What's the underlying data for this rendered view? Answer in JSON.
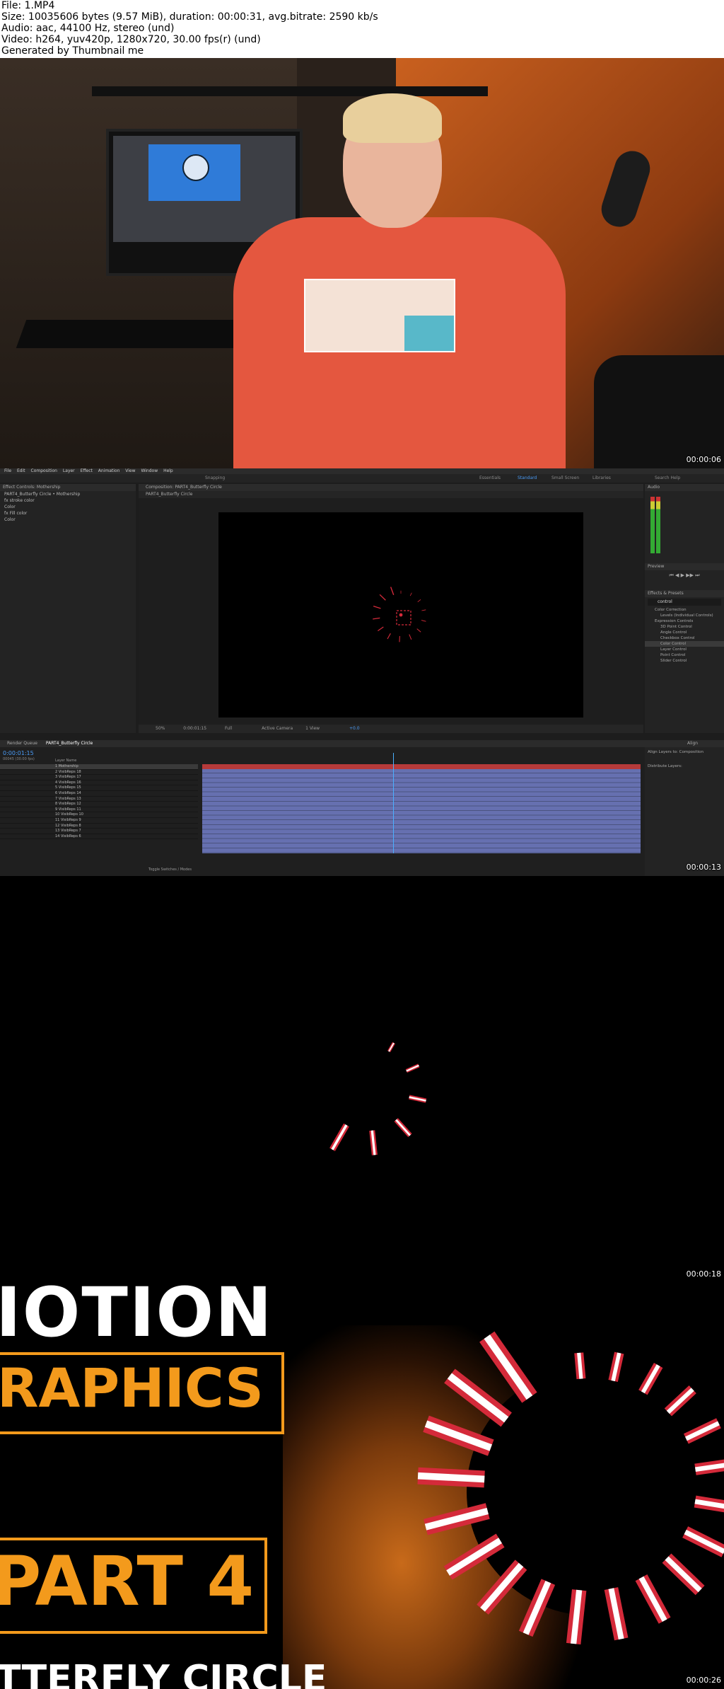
{
  "header": {
    "lines": [
      "File: 1.MP4",
      "Size: 10035606 bytes (9.57 MiB), duration: 00:00:31, avg.bitrate: 2590 kb/s",
      "Audio: aac, 44100 Hz, stereo (und)",
      "Video: h264, yuv420p, 1280x720, 30.00 fps(r) (und)",
      "Generated by Thumbnail me"
    ]
  },
  "frames": {
    "f1": {
      "timestamp": "00:00:06"
    },
    "f2": {
      "timestamp": "00:00:13"
    },
    "f3": {
      "timestamp": "00:00:18"
    },
    "f4": {
      "timestamp": "00:00:26"
    }
  },
  "ae": {
    "menu": [
      "File",
      "Edit",
      "Composition",
      "Layer",
      "Effect",
      "Animation",
      "View",
      "Window",
      "Help"
    ],
    "toolbar": {
      "snapping": "Snapping",
      "workspaces": [
        "Essentials",
        "Standard",
        "Small Screen",
        "Libraries"
      ],
      "search": "Search Help"
    },
    "effect_controls": {
      "tab": "Effect Controls: Mothership",
      "subtitle": "PART4_Butterfly Circle • Mothership",
      "rows": [
        "fx  stroke color",
        "    Color",
        "fx  Fill color",
        "    Color"
      ]
    },
    "composition": {
      "tab": "Composition: PART4_Butterfly Circle",
      "subtab": "PART4_Butterfly Circle",
      "status": [
        "50%",
        "0:00:01:15",
        "Full",
        "Active Camera",
        "1 View",
        "+0.0"
      ]
    },
    "right": {
      "audio": "Audio",
      "preview": "Preview",
      "effects": "Effects & Presets",
      "search": "control",
      "fx_items": [
        "Color Correction",
        "Levels (Individual Controls)",
        "Expression Controls",
        "3D Point Control",
        "Angle Control",
        "Checkbox Control",
        "Color Control",
        "Layer Control",
        "Point Control",
        "Slider Control"
      ],
      "align": "Align",
      "align_to": "Align Layers to:",
      "composition_label": "Composition",
      "distribute": "Distribute Layers:"
    },
    "timeline": {
      "tabs": [
        "Render Queue",
        "PART4_Butterfly Circle"
      ],
      "timecode": "0:00:01:15",
      "fps": "00045 (30.00 fps)",
      "col_header": "Layer Name",
      "layers": [
        "Mothership",
        "VisibReps 18",
        "VisibReps 17",
        "VisibReps 16",
        "VisibReps 15",
        "VisibReps 14",
        "VisibReps 13",
        "VisibReps 12",
        "VisibReps 11",
        "VisibReps 10",
        "VisibReps 9",
        "VisibReps 8",
        "VisibReps 7",
        "VisibReps 6"
      ],
      "toggle": "Toggle Switches / Modes"
    }
  },
  "title_card": {
    "line1": "IOTION",
    "line2": "RAPHICS",
    "line3": "PART 4",
    "line4": "TTERFLY CIRCLE"
  },
  "colors": {
    "accent_orange": "#f39a1c",
    "spinner_red": "#d42a3a",
    "ae_blue": "#4a9bf5"
  }
}
